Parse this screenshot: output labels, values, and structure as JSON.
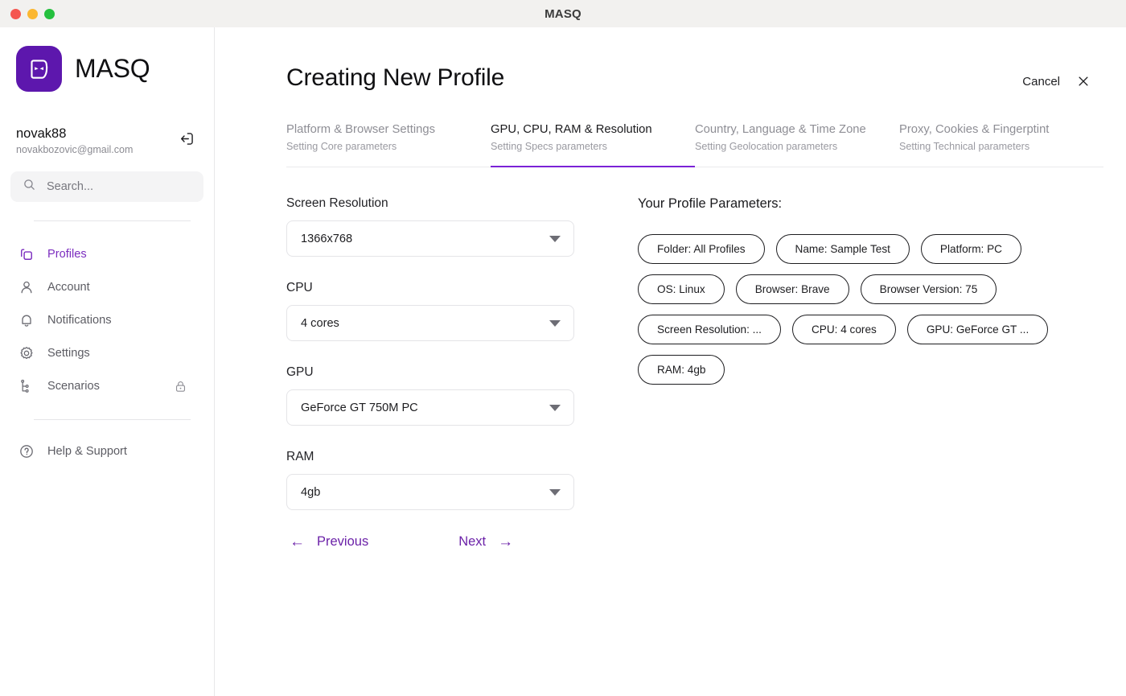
{
  "window": {
    "title": "MASQ",
    "controls": [
      "close",
      "minimize",
      "maximize"
    ]
  },
  "sidebar": {
    "brand": {
      "name": "MASQ",
      "logo_icon": "masq-mask-logo-icon",
      "logo_color": "#5d17ad"
    },
    "user": {
      "name": "novak88",
      "email": "novakbozovic@gmail.com",
      "logout_icon": "logout-icon"
    },
    "search": {
      "placeholder": "Search...",
      "value": "",
      "icon": "search-icon"
    },
    "items": [
      {
        "label": "Profiles",
        "icon": "profiles-copy-icon",
        "active": true,
        "locked": false
      },
      {
        "label": "Account",
        "icon": "user-icon",
        "active": false,
        "locked": false
      },
      {
        "label": "Notifications",
        "icon": "bell-icon",
        "active": false,
        "locked": false
      },
      {
        "label": "Settings",
        "icon": "gear-icon",
        "active": false,
        "locked": false
      },
      {
        "label": "Scenarios",
        "icon": "sitemap-icon",
        "active": false,
        "locked": true,
        "lock_icon": "lock-icon"
      }
    ],
    "footer": [
      {
        "label": "Help & Support",
        "icon": "question-circle-icon"
      }
    ],
    "accent_color": "#7b2cbf"
  },
  "header": {
    "title": "Creating New Profile",
    "cancel_label": "Cancel",
    "close_icon": "close-icon"
  },
  "tabs": [
    {
      "label": "Platform & Browser Settings",
      "sub": "Setting Core parameters",
      "active": false
    },
    {
      "label": "GPU, CPU, RAM & Resolution",
      "sub": "Setting Specs parameters",
      "active": true
    },
    {
      "label": "Country, Language & Time Zone",
      "sub": "Setting Geolocation parameters",
      "active": false
    },
    {
      "label": "Proxy, Cookies & Fingerptint",
      "sub": "Setting Technical parameters",
      "active": false
    }
  ],
  "form": {
    "fields": [
      {
        "label": "Screen Resolution",
        "value": "1366x768"
      },
      {
        "label": "CPU",
        "value": "4 cores"
      },
      {
        "label": "GPU",
        "value": "GeForce GT 750M PC"
      },
      {
        "label": "RAM",
        "value": "4gb"
      }
    ],
    "previous_label": "Previous",
    "next_label": "Next",
    "prev_arrow": "←",
    "next_arrow": "→"
  },
  "params": {
    "title": "Your Profile Parameters:",
    "chips": [
      "Folder: All Profiles",
      "Name: Sample Test",
      "Platform: PC",
      "OS: Linux",
      "Browser: Brave",
      "Browser Version: 75",
      "Screen Resolution: ...",
      "CPU: 4 cores",
      "GPU: GeForce GT ...",
      "RAM: 4gb"
    ]
  }
}
